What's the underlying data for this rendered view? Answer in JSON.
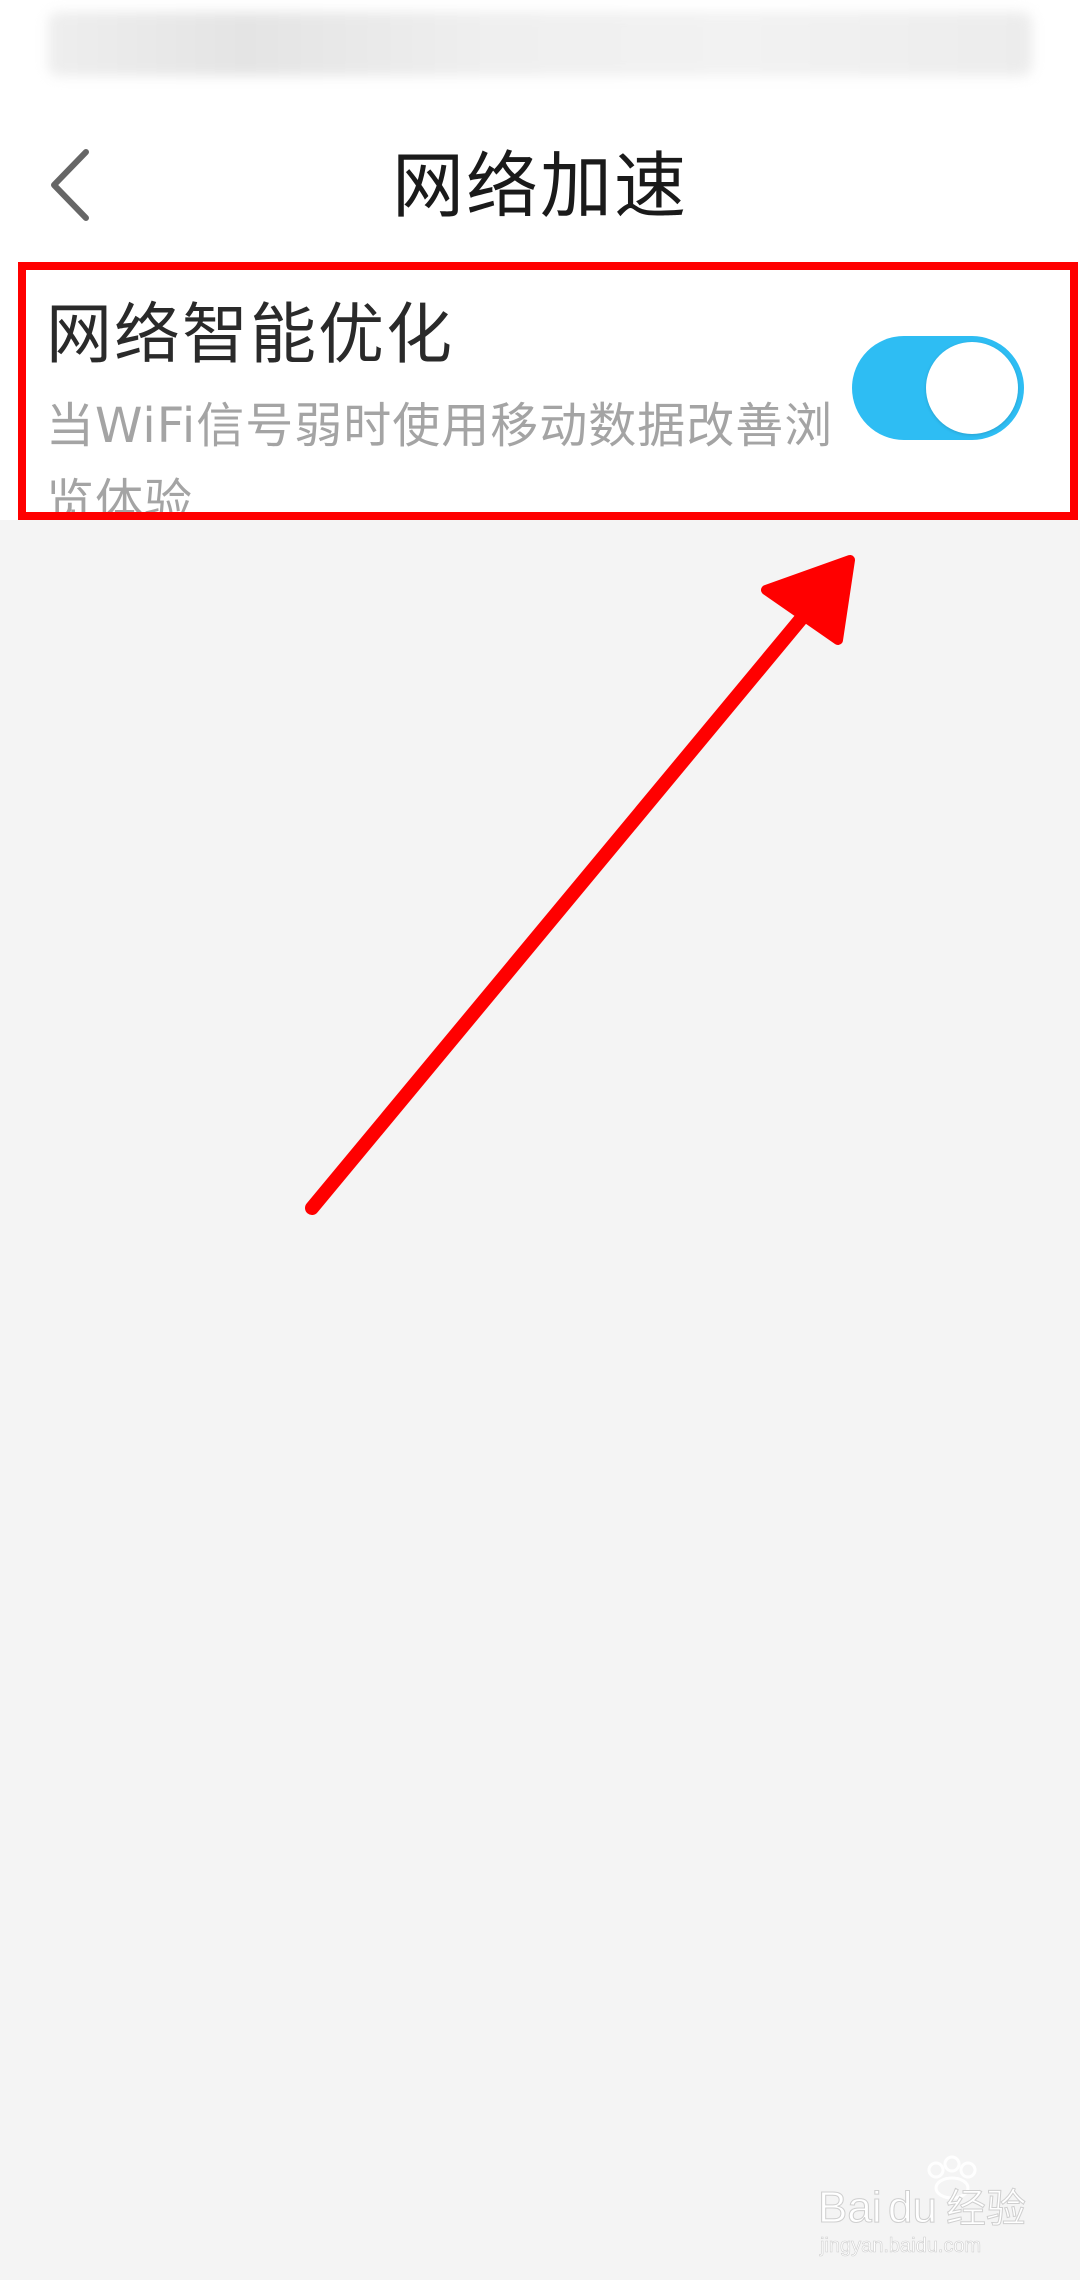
{
  "header": {
    "title": "网络加速",
    "back_icon": "chevron-left-icon"
  },
  "setting": {
    "title": "网络智能优化",
    "description": "当WiFi信号弱时使用移动数据改善浏览体验",
    "toggle_state": "on"
  },
  "watermark": {
    "brand": "Baidu经验",
    "url": "jingyan.baidu.com"
  },
  "colors": {
    "background": "#f4f4f4",
    "surface": "#ffffff",
    "toggle_on": "#2ebdf3",
    "annotation": "#ff0000",
    "title_text": "#1a1a1a",
    "secondary_text": "#a4a4a4"
  }
}
